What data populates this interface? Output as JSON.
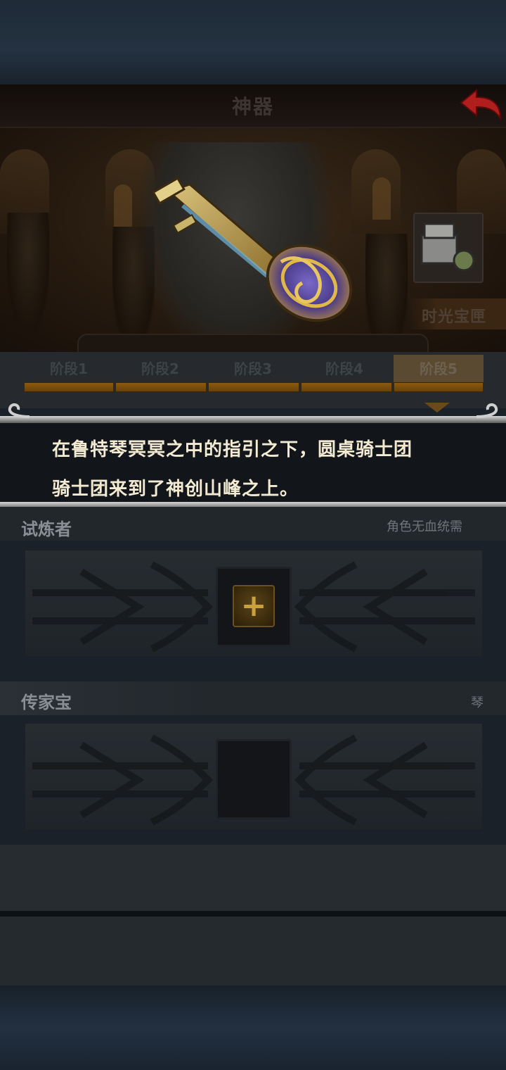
{
  "header": {
    "title": "神器"
  },
  "chest": {
    "label": "时光宝匣"
  },
  "stages": {
    "tabs": [
      "阶段1",
      "阶段2",
      "阶段3",
      "阶段4",
      "阶段5"
    ],
    "active_index": 4
  },
  "dialog": {
    "line1": "在鲁特琴冥冥之中的指引之下，圆桌骑士团",
    "line2": "骑士团来到了神创山峰之上。"
  },
  "trainer": {
    "title": "试炼者",
    "note": "角色无血统需"
  },
  "heirloom": {
    "title": "传家宝",
    "note": "琴"
  },
  "icons": {
    "back": "back-arrow-icon",
    "add": "plus-icon",
    "chest": "treasure-chest-icon"
  },
  "colors": {
    "accent": "#8a5a12",
    "dialog_text": "#f3ead2",
    "back_arrow": "#b01e1e"
  }
}
